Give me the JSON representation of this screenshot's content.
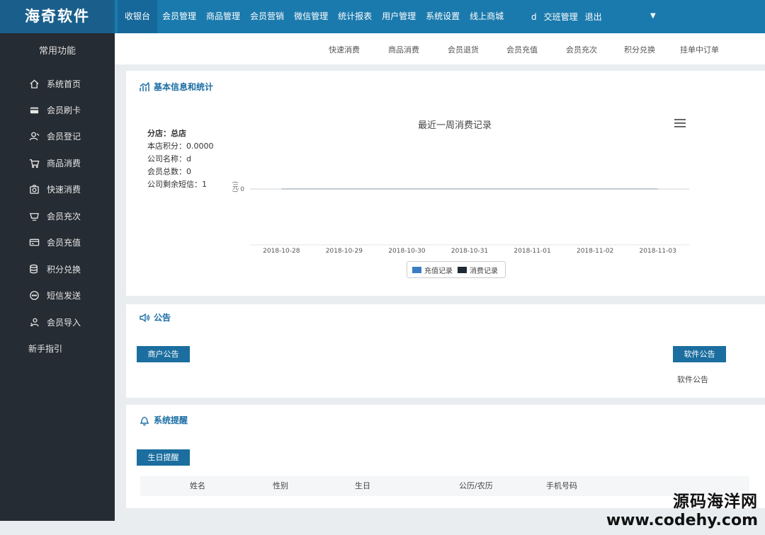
{
  "brand": {
    "name": "海奇软件"
  },
  "topnav": {
    "items": [
      "收银台",
      "会员管理",
      "商品管理",
      "会员营销",
      "微信管理",
      "统计报表",
      "用户管理",
      "系统设置",
      "线上商城"
    ],
    "user": "d",
    "shift": "交班管理",
    "logout": "退出"
  },
  "sidebar": {
    "title": "常用功能",
    "items": [
      "系统首页",
      "会员刷卡",
      "会员登记",
      "商品消费",
      "快速消费",
      "会员充次",
      "会员充值",
      "积分兑换",
      "短信发送",
      "会员导入",
      "新手指引"
    ]
  },
  "subnav": {
    "items": [
      "快速消费",
      "商品消费",
      "会员退货",
      "会员充值",
      "会员充次",
      "积分兑换",
      "挂单中订单"
    ]
  },
  "stats": {
    "title": "基本信息和统计",
    "shop": "分店：总店",
    "points": "本店积分：0.0000",
    "company": "公司名称：d",
    "members": "会员总数：0",
    "sms": "公司剩余短信：1"
  },
  "chart_data": {
    "type": "line",
    "title": "最近一周消费记录",
    "ylabel": "(元)",
    "x": [
      "2018-10-28",
      "2018-10-29",
      "2018-10-30",
      "2018-10-31",
      "2018-11-01",
      "2018-11-02",
      "2018-11-03"
    ],
    "yticks": [
      "0"
    ],
    "series": [
      {
        "name": "充值记录",
        "values": [
          0,
          0,
          0,
          0,
          0,
          0,
          0
        ],
        "color": "#3b7dc4"
      },
      {
        "name": "消费记录",
        "values": [
          0,
          0,
          0,
          0,
          0,
          0,
          0
        ],
        "color": "#1d2a35"
      }
    ],
    "legend": "bottom-center"
  },
  "notice": {
    "title": "公告",
    "merchant_btn": "商户公告",
    "software_btn": "软件公告",
    "software_text": "软件公告"
  },
  "reminder": {
    "title": "系统提醒",
    "birthday_btn": "生日提醒",
    "columns": [
      "姓名",
      "性别",
      "生日",
      "公历/农历",
      "手机号码"
    ]
  },
  "watermark": {
    "line1": "源码海洋网",
    "line2": "www.codehy.com"
  },
  "colors": {
    "topbar": "#1b7aad",
    "sidebar": "#262c33",
    "accent": "#1b6e9f"
  }
}
